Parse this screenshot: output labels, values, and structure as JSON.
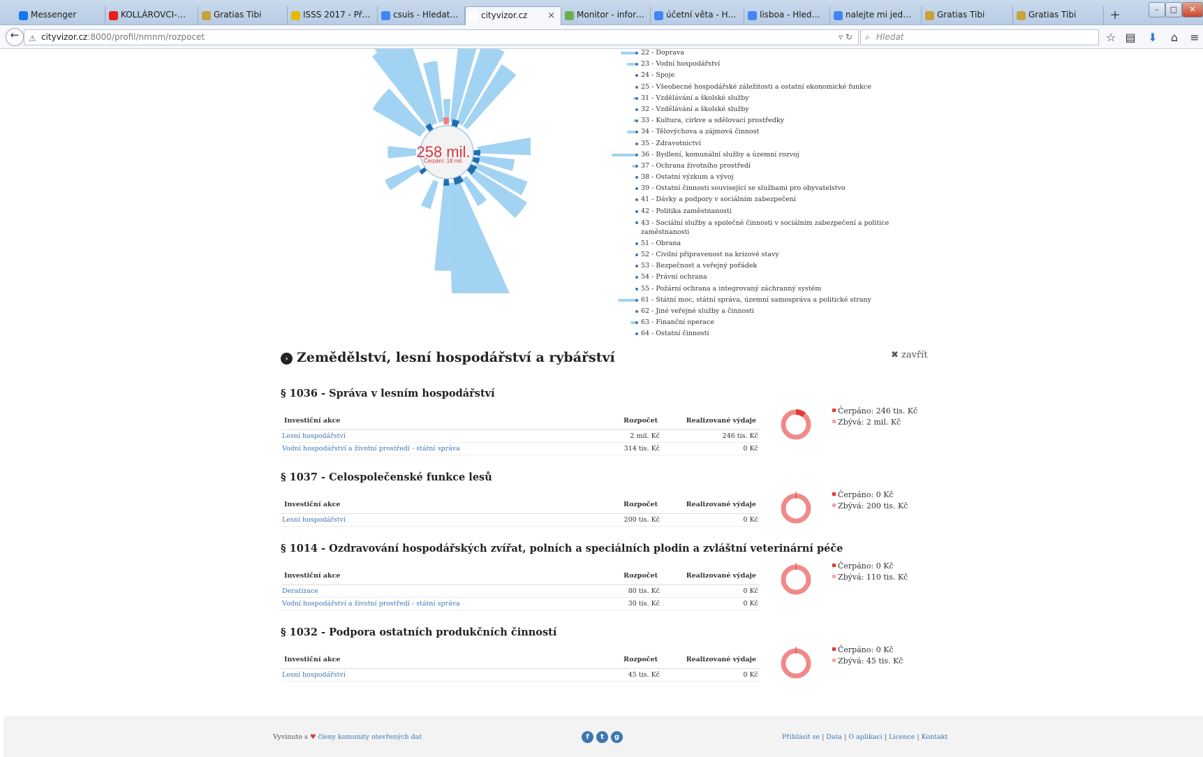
{
  "browser": {
    "tabs": [
      {
        "label": "Messenger",
        "color": "#1877f2"
      },
      {
        "label": "KOLLÁROVCI-GO...",
        "color": "#e62117"
      },
      {
        "label": "Gratias Tibi",
        "color": "#c8a23a"
      },
      {
        "label": "ISSS 2017 - Předb...",
        "color": "#e6b800"
      },
      {
        "label": "csuis - Hledat Go...",
        "color": "#4285f4"
      },
      {
        "label": "cityvizor.cz",
        "color": "#ffffff",
        "close": "×"
      },
      {
        "label": "Monitor - inform...",
        "color": "#6ab04c"
      },
      {
        "label": "účetní věta - Hled...",
        "color": "#4285f4"
      },
      {
        "label": "lisboa - Hledat G...",
        "color": "#4285f4"
      },
      {
        "label": "nalejte mi jedno č...",
        "color": "#4285f4"
      },
      {
        "label": "Gratias Tibi",
        "color": "#c8a23a"
      },
      {
        "label": "Gratias Tibi",
        "color": "#c8a23a"
      }
    ],
    "new_tab": "+",
    "url_host": "cityvizor.cz",
    "url_path": ":8000/profil/nmnm/rozpocet",
    "search_placeholder": "Hledat"
  },
  "viz": {
    "center_value": "258 mil.",
    "center_sub": "Čerpání: 18 mil.",
    "colors": {
      "light": "#a3d3f2",
      "dark": "#1f6fb2",
      "red": "#f08080"
    }
  },
  "legend": [
    {
      "label": "22 - Doprava",
      "bar": 0.25
    },
    {
      "label": "23 - Vodní hospodářství",
      "bar": 0.15
    },
    {
      "label": "24 - Spoje",
      "bar": 0
    },
    {
      "label": "25 - Všeobecné hospodářské záležitosti a ostatní ekonomické funkce",
      "bar": 0
    },
    {
      "label": "31 - Vzdělávání a školské služby",
      "bar": 0.05
    },
    {
      "label": "32 - Vzdělávání a školské služby",
      "bar": 0
    },
    {
      "label": "33 - Kultura, církve a sdělovací prostředky",
      "bar": 0.05
    },
    {
      "label": "34 - Tělovýchova a zájmová činnost",
      "bar": 0.15
    },
    {
      "label": "35 - Zdravotnictví",
      "bar": 0
    },
    {
      "label": "36 - Bydlení, komunální služby a územní rozvoj",
      "bar": 0.4
    },
    {
      "label": "37 - Ochrana životního prostředí",
      "bar": 0.08
    },
    {
      "label": "38 - Ostatní výzkum a vývoj",
      "bar": 0
    },
    {
      "label": "39 - Ostatní činnosti související se službami pro obyvatelstvo",
      "bar": 0
    },
    {
      "label": "41 - Dávky a podpory v sociálním zabezpečení",
      "bar": 0
    },
    {
      "label": "42 - Politika zaměstnanosti",
      "bar": 0
    },
    {
      "label": "43 - Sociální služby a společné činnosti v sociálním zabezpečení a politice zaměstnanosti",
      "bar": 0,
      "wrap": true
    },
    {
      "label": "51 - Obrana",
      "bar": 0
    },
    {
      "label": "52 - Civilní připravenost na krizové stavy",
      "bar": 0
    },
    {
      "label": "53 - Bezpečnost a veřejný pořádek",
      "bar": 0
    },
    {
      "label": "54 - Právní ochrana",
      "bar": 0
    },
    {
      "label": "55 - Požární ochrana a integrovaný záchranný systém",
      "bar": 0
    },
    {
      "label": "61 - Státní moc, státní správa, územní samospráva a politické strany",
      "bar": 0.3
    },
    {
      "label": "62 - Jiné veřejné služby a činnosti",
      "bar": 0
    },
    {
      "label": "63 - Finanční operace",
      "bar": 0.1
    },
    {
      "label": "64 - Ostatní činnosti",
      "bar": 0
    }
  ],
  "detail": {
    "icon": "›",
    "title": "Zemědělství, lesní hospodářství a rybářství",
    "close_label": "✖ zavřít",
    "col_action": "Investiční akce",
    "col_budget": "Rozpočet",
    "col_spent": "Realizované výdaje",
    "sections": [
      {
        "title": "§ 1036 - Správa v lesním hospodářství",
        "rows": [
          {
            "action": "Lesní hospodářství",
            "budget": "2 mil. Kč",
            "spent": "246 tis. Kč"
          },
          {
            "action": "Vodní hospodářství a životní prostředí - státní správa",
            "budget": "314 tis. Kč",
            "spent": "0 Kč"
          }
        ],
        "spent_label": "Čerpáno: 246 tis. Kč",
        "remain_label": "Zbývá: 2 mil. Kč",
        "spent_fraction": 0.11
      },
      {
        "title": "§ 1037 - Celospolečenské funkce lesů",
        "rows": [
          {
            "action": "Lesní hospodářství",
            "budget": "200 tis. Kč",
            "spent": "0 Kč"
          }
        ],
        "spent_label": "Čerpáno: 0 Kč",
        "remain_label": "Zbývá: 200 tis. Kč",
        "spent_fraction": 0
      },
      {
        "title": "§ 1014 - Ozdravování hospodářských zvířat, polních a speciálních plodin a zvláštní veterinární péče",
        "rows": [
          {
            "action": "Deratizace",
            "budget": "80 tis. Kč",
            "spent": "0 Kč"
          },
          {
            "action": "Vodní hospodářství a životní prostředí - státní správa",
            "budget": "30 tis. Kč",
            "spent": "0 Kč"
          }
        ],
        "spent_label": "Čerpáno: 0 Kč",
        "remain_label": "Zbývá: 110 tis. Kč",
        "spent_fraction": 0
      },
      {
        "title": "§ 1032 - Podpora ostatních produkčních činností",
        "rows": [
          {
            "action": "Lesní hospodářství",
            "budget": "45 tis. Kč",
            "spent": "0 Kč"
          }
        ],
        "spent_label": "Čerpáno: 0 Kč",
        "remain_label": "Zbývá: 45 tis. Kč",
        "spent_fraction": 0
      }
    ]
  },
  "footer": {
    "made_prefix": "Vyvinuto s",
    "made_link": "členy komunity otevřených dat",
    "social": [
      "f",
      "t",
      "g"
    ],
    "links": [
      "Přihlásit se",
      "Data",
      "O aplikaci",
      "Licence",
      "Kontakt"
    ]
  }
}
